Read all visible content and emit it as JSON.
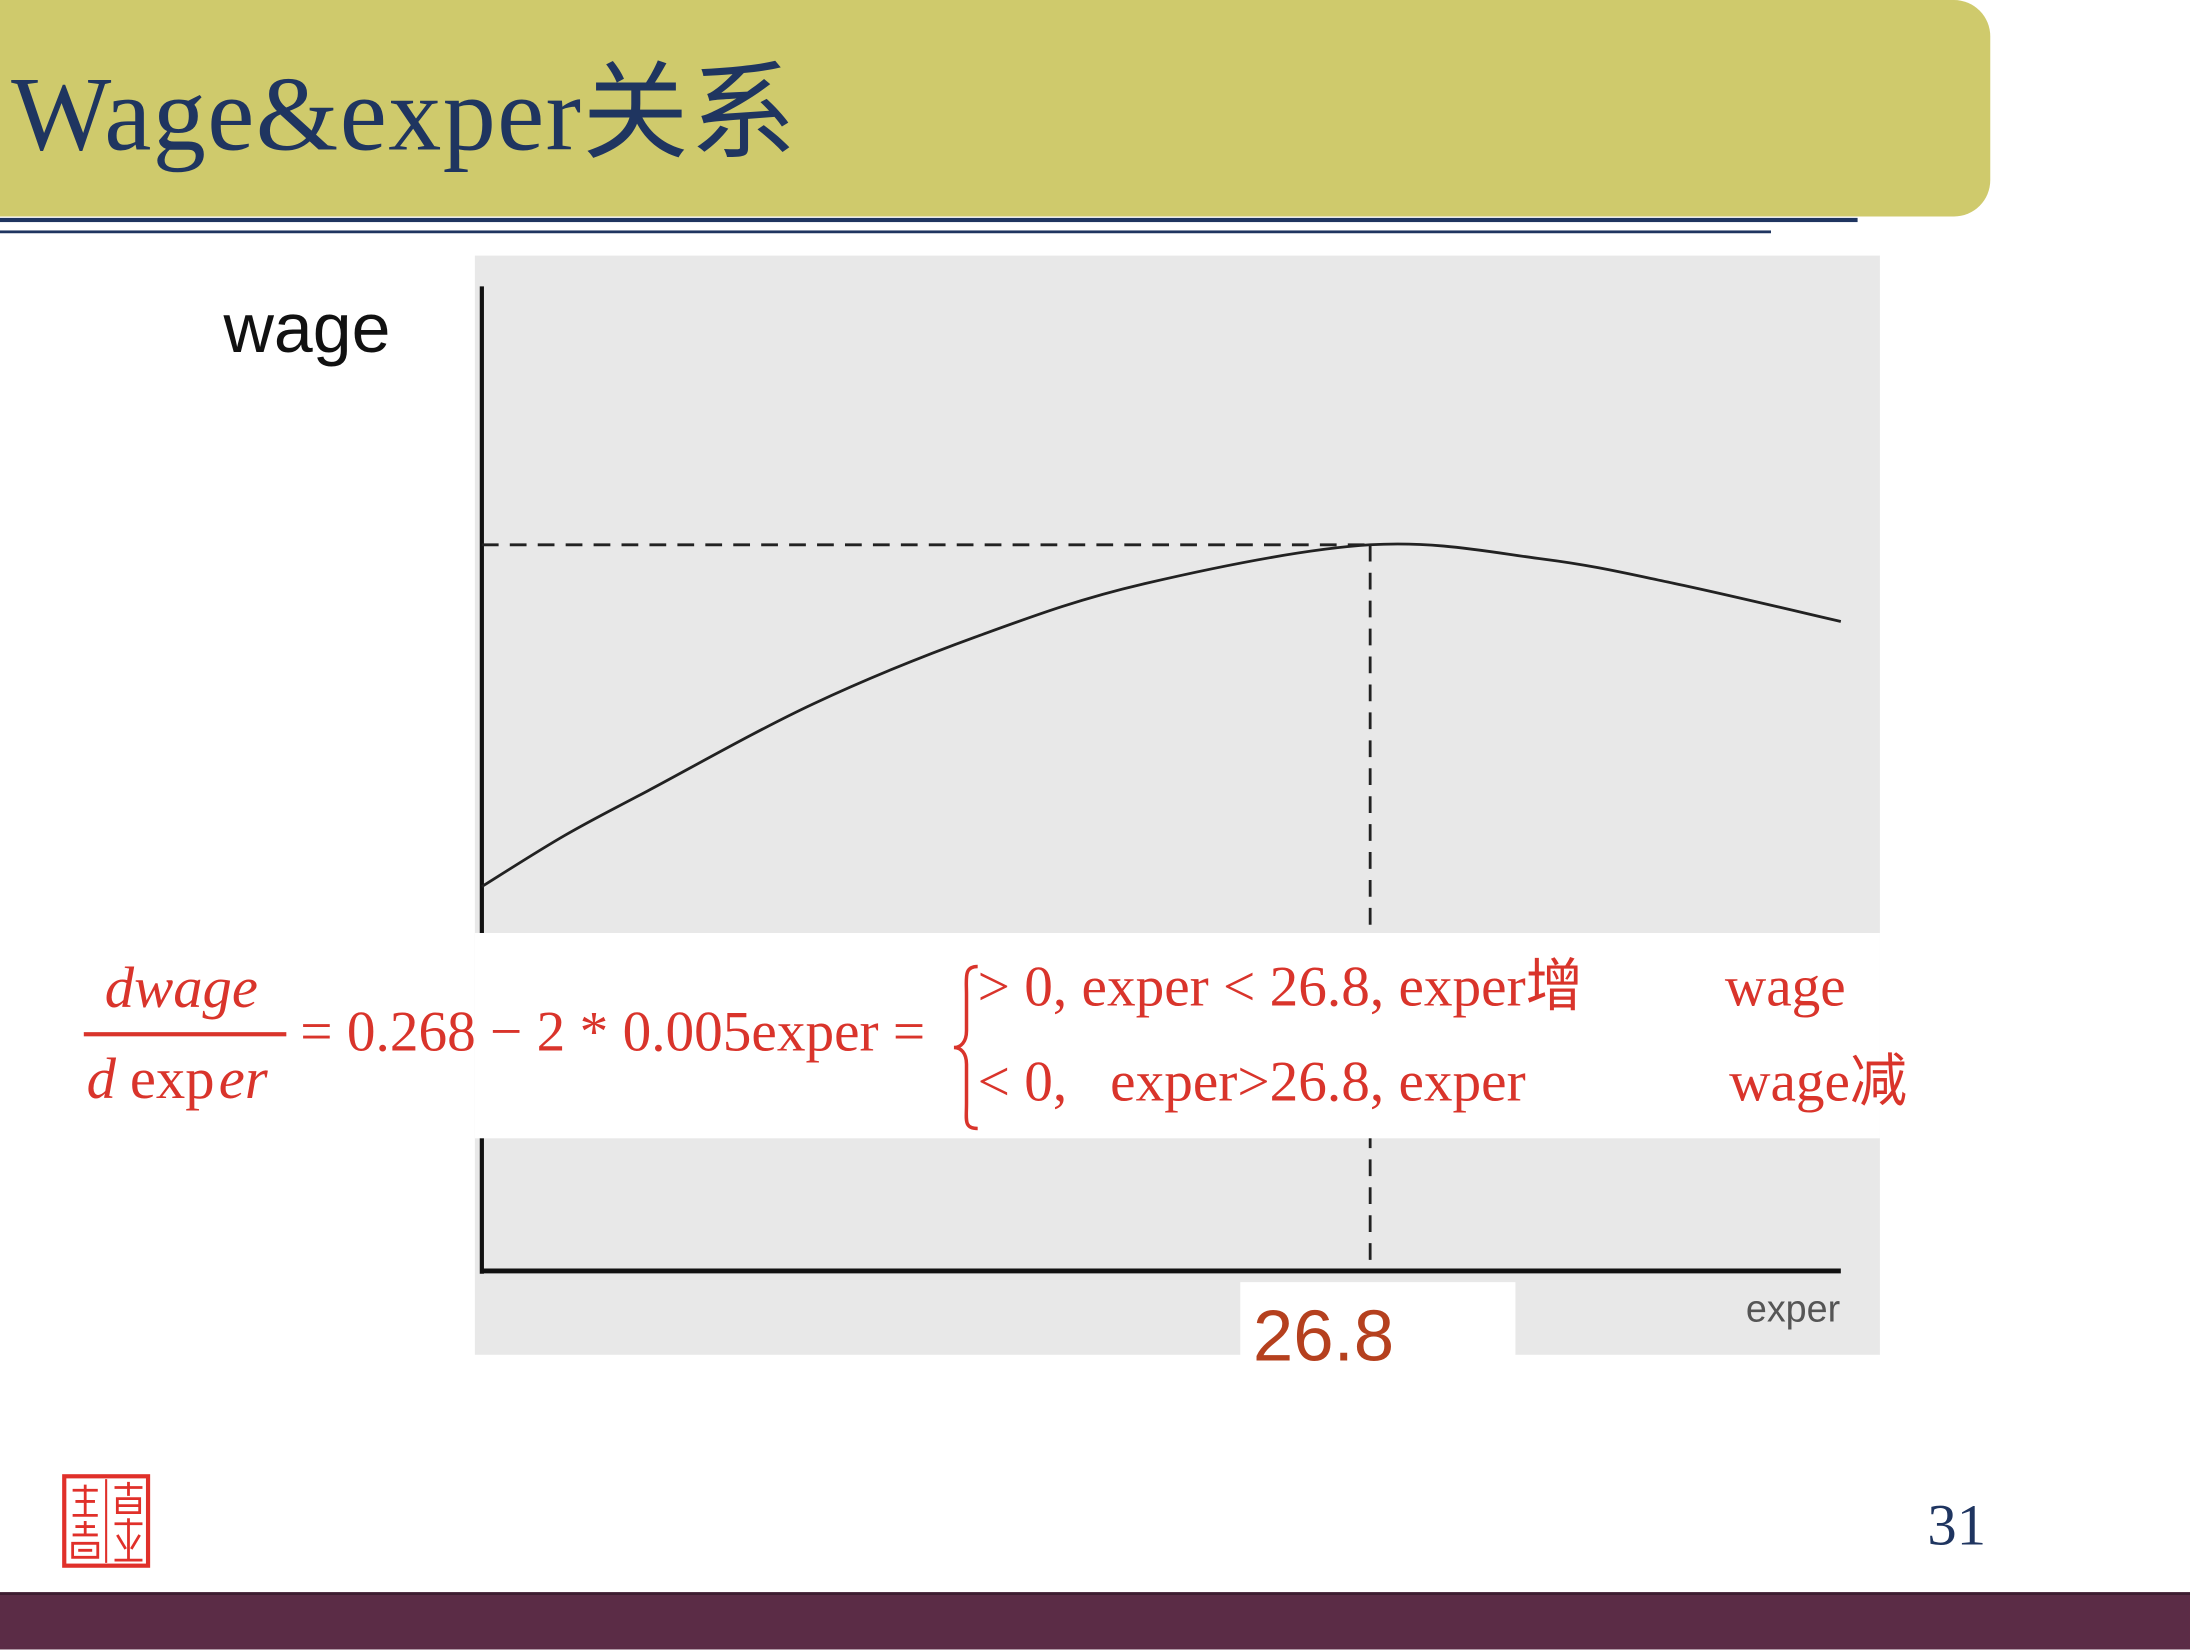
{
  "slide": {
    "title": "Wage&exper关系",
    "page_number": "31"
  },
  "colors": {
    "title_bar": "#cfca6c",
    "title_text": "#1f3560",
    "plot_background": "#e8e8e8",
    "formula_text": "#d9342b",
    "marker_label": "#b5401e",
    "footer_band": "#5b2c46",
    "seal": "#e0302a"
  },
  "formula": {
    "numerator": "dwage",
    "denominator": {
      "d": "d",
      "exp": "exp",
      "er": "er"
    },
    "rhs": "= 0.268 − 2 * 0.005exper =",
    "cases": [
      {
        "condition": "> 0, exper < 26.8, exper增",
        "result": "wage"
      },
      {
        "condition": "< 0,   exper>26.8, exper",
        "result": "wage减"
      }
    ]
  },
  "chart_data": {
    "type": "line",
    "xlabel": "exper",
    "ylabel": "wage",
    "xlim": [
      0,
      41
    ],
    "ylim": [
      0,
      10.4
    ],
    "grid": false,
    "x_marker": 26.8,
    "x_marker_label": "26.8",
    "series": [
      {
        "x": [
          0,
          2.5,
          5,
          10,
          15,
          20,
          26.8,
          32,
          36,
          41
        ],
        "y": [
          4.06,
          4.6,
          5.07,
          5.99,
          6.71,
          7.26,
          7.67,
          7.52,
          7.26,
          6.86
        ]
      }
    ]
  },
  "logo": {
    "icon": "seal-icon"
  }
}
